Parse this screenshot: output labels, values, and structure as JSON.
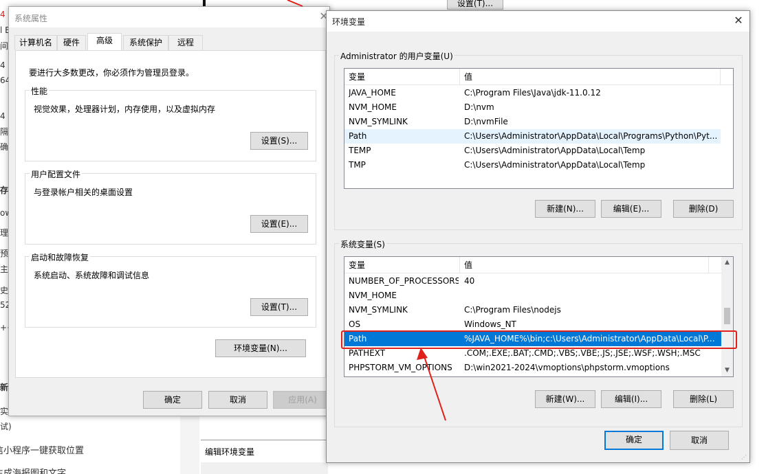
{
  "background": {
    "left_fragments": [
      "4",
      "l E",
      "间近",
      "4",
      "64",
      "4",
      "隔。",
      "确里",
      "存",
      "ow",
      "理出",
      "预算",
      "主义",
      "史工",
      "52",
      "++",
      "",
      "新交",
      "实",
      "试)"
    ],
    "bottom_texts": [
      "信小程序一键获取位置",
      "生成海报图和文字"
    ],
    "top_button": "设置(T)...",
    "edit_env_title": "编辑环境变量"
  },
  "sysprop": {
    "title": "系统属性",
    "tabs": [
      {
        "label": "计算机名",
        "active": false
      },
      {
        "label": "硬件",
        "active": false
      },
      {
        "label": "高级",
        "active": true
      },
      {
        "label": "系统保护",
        "active": false
      },
      {
        "label": "远程",
        "active": false
      }
    ],
    "admin_note": "要进行大多数更改，你必须作为管理员登录。",
    "groups": [
      {
        "label": "性能",
        "desc": "视觉效果，处理器计划，内存使用，以及虚拟内存",
        "button": "设置(S)..."
      },
      {
        "label": "用户配置文件",
        "desc": "与登录帐户相关的桌面设置",
        "button": "设置(E)..."
      },
      {
        "label": "启动和故障恢复",
        "desc": "系统启动、系统故障和调试信息",
        "button": "设置(T)..."
      }
    ],
    "env_button": "环境变量(N)...",
    "ok": "确定",
    "cancel": "取消",
    "apply": "应用(A)"
  },
  "envvar": {
    "title": "环境变量",
    "user_section_label": "Administrator 的用户变量(U)",
    "system_section_label": "系统变量(S)",
    "col_variable": "变量",
    "col_value": "值",
    "user_rows": [
      {
        "name": "JAVA_HOME",
        "value": "C:\\Program Files\\Java\\jdk-11.0.12",
        "state": ""
      },
      {
        "name": "NVM_HOME",
        "value": "D:\\nvm",
        "state": ""
      },
      {
        "name": "NVM_SYMLINK",
        "value": "D:\\nvmFile",
        "state": ""
      },
      {
        "name": "Path",
        "value": "C:\\Users\\Administrator\\AppData\\Local\\Programs\\Python\\Pyt...",
        "state": "hover"
      },
      {
        "name": "TEMP",
        "value": "C:\\Users\\Administrator\\AppData\\Local\\Temp",
        "state": ""
      },
      {
        "name": "TMP",
        "value": "C:\\Users\\Administrator\\AppData\\Local\\Temp",
        "state": ""
      }
    ],
    "system_rows": [
      {
        "name": "NUMBER_OF_PROCESSORS",
        "value": "40",
        "state": ""
      },
      {
        "name": "NVM_HOME",
        "value": "",
        "state": ""
      },
      {
        "name": "NVM_SYMLINK",
        "value": "C:\\Program Files\\nodejs",
        "state": ""
      },
      {
        "name": "OS",
        "value": "Windows_NT",
        "state": ""
      },
      {
        "name": "Path",
        "value": "%JAVA_HOME%\\bin;c:\\Users\\Administrator\\AppData\\Local\\P...",
        "state": "sel"
      },
      {
        "name": "PATHEXT",
        "value": ".COM;.EXE;.BAT;.CMD;.VBS;.VBE;.JS;.JSE;.WSF;.WSH;.MSC",
        "state": ""
      },
      {
        "name": "PHPSTORM_VM_OPTIONS",
        "value": "D:\\win2021-2024\\vmoptions\\phpstorm.vmoptions",
        "state": ""
      }
    ],
    "user_buttons": {
      "new": "新建(N)...",
      "edit": "编辑(E)...",
      "delete": "删除(D)"
    },
    "system_buttons": {
      "new": "新建(W)...",
      "edit": "编辑(I)...",
      "delete": "删除(L)"
    },
    "ok": "确定",
    "cancel": "取消"
  },
  "colors": {
    "annotation_red": "#e0201a",
    "selection_blue": "#0078d7",
    "hover_blue": "#e5f3ff"
  }
}
